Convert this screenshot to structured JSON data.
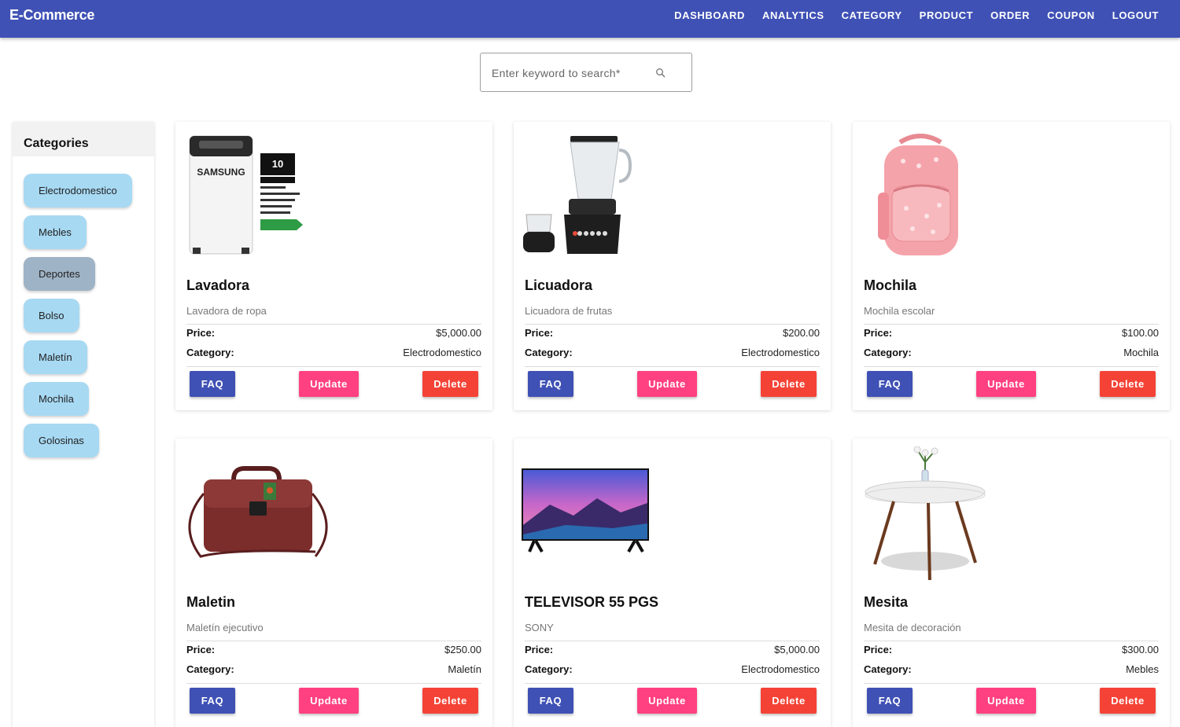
{
  "app": {
    "brand": "E-Commerce"
  },
  "nav": [
    "DASHBOARD",
    "ANALYTICS",
    "CATEGORY",
    "PRODUCT",
    "ORDER",
    "COUPON",
    "LOGOUT"
  ],
  "search": {
    "placeholder": "Enter keyword to search*",
    "value": ""
  },
  "sidebar": {
    "title": "Categories",
    "items": [
      "Electrodomestico",
      "Mebles",
      "Deportes",
      "Bolso",
      "Maletín",
      "Mochila",
      "Golosinas"
    ],
    "selected": "Deportes"
  },
  "labels": {
    "price": "Price:",
    "category": "Category:",
    "faq": "FAQ",
    "update": "Update",
    "delete": "Delete"
  },
  "products": [
    {
      "name": "Lavadora",
      "description": "Lavadora de ropa",
      "price": "$5,000.00",
      "category": "Electrodomestico",
      "image": "washing-machine"
    },
    {
      "name": "Licuadora",
      "description": "Licuadora de frutas",
      "price": "$200.00",
      "category": "Electrodomestico",
      "image": "blender"
    },
    {
      "name": "Mochila",
      "description": "Mochila escolar",
      "price": "$100.00",
      "category": "Mochila",
      "image": "backpack"
    },
    {
      "name": "Maletin",
      "description": "Maletín ejecutivo",
      "price": "$250.00",
      "category": "Maletín",
      "image": "briefcase"
    },
    {
      "name": "TELEVISOR 55 PGS",
      "description": "SONY",
      "price": "$5,000.00",
      "category": "Electrodomestico",
      "image": "television"
    },
    {
      "name": "Mesita",
      "description": "Mesita de decoración",
      "price": "$300.00",
      "category": "Mebles",
      "image": "side-table"
    }
  ],
  "colors": {
    "primary": "#3f51b5",
    "accent": "#ff4081",
    "warn": "#f44336",
    "chip": "#a7d9f3",
    "chip_selected": "#9fb3c6"
  }
}
